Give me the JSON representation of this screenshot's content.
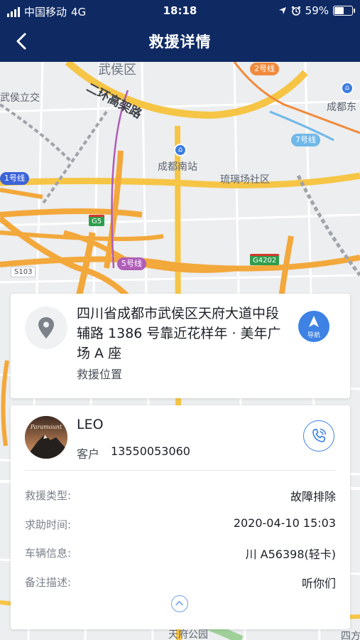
{
  "status_bar": {
    "carrier": "中国移动",
    "network": "4G",
    "time": "18:18",
    "battery": "59%",
    "battery_level": 0.59
  },
  "nav": {
    "title": "救援详情",
    "back_icon": "chevron-left-icon"
  },
  "map": {
    "labels": {
      "wuhou_district": "武侯区",
      "wuhou_lijiao": "武侯立交",
      "second_ring": "二环高架路",
      "chengdu_south": "成都南站",
      "liulichang": "琉璃场社区",
      "chengdu_east": "成都东",
      "line2": "2号线",
      "line7": "7号线",
      "line5": "5号线",
      "line1": "1号线",
      "g5": "G5",
      "g4202": "G4202",
      "s103": "S103",
      "tianfu_park": "天府公园",
      "sifang": "四方"
    },
    "colors": {
      "major_road": "#f3a83b",
      "ring_road": "#f6c545",
      "metro_line2": "#f08a3c",
      "metro_line7": "#70b8e8",
      "metro_line5": "#b05db8",
      "metro_line1": "#3c64d8"
    }
  },
  "location_card": {
    "address": "四川省成都市武侯区天府大道中段辅路 1386 号靠近花样年 · 美年广场 A 座",
    "label": "救援位置",
    "nav_button": "导航",
    "location_icon": "map-pin-icon"
  },
  "customer_card": {
    "name": "LEO",
    "type": "客户",
    "phone": "13550053060",
    "avatar_text": "Paramount",
    "call_icon": "phone-icon",
    "rows": [
      {
        "label": "救援类型:",
        "value": "故障排除"
      },
      {
        "label": "求助时间:",
        "value": "2020-04-10 15:03"
      },
      {
        "label": "车辆信息:",
        "value": "川 A56398(轻卡)"
      },
      {
        "label": "备注描述:",
        "value": "听你们"
      }
    ],
    "collapse_icon": "chevron-up-icon"
  },
  "theme": {
    "header_bg": "#0f2a63",
    "accent": "#3d82e4"
  }
}
